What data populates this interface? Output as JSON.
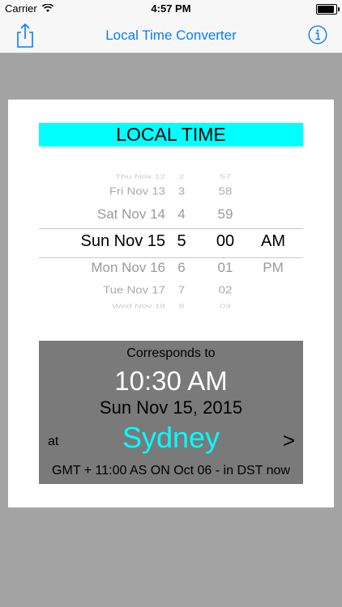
{
  "status": {
    "carrier": "Carrier",
    "time": "4:57 PM",
    "battery_level": 1.0
  },
  "nav": {
    "title": "Local Time Converter",
    "left_icon": "share-icon",
    "right_icon": "info-icon"
  },
  "colors": {
    "accent": "#0a7aff",
    "cyan": "#00ffff",
    "panel": "#7a7a7a",
    "background": "#a3a3a3"
  },
  "header": {
    "label": "LOCAL TIME"
  },
  "picker": {
    "dates": [
      "Thu Nov 12",
      "Fri Nov 13",
      "Sat Nov 14",
      "Sun Nov 15",
      "Mon Nov 16",
      "Tue Nov 17",
      "Wed Nov 18"
    ],
    "hours": [
      "2",
      "3",
      "4",
      "5",
      "6",
      "7",
      "8"
    ],
    "minutes": [
      "57",
      "58",
      "59",
      "00",
      "01",
      "02",
      "03"
    ],
    "ampm": [
      "AM",
      "PM"
    ],
    "selected": {
      "date": "Sun Nov 15",
      "hour": "5",
      "minute": "00",
      "ampm": "AM"
    }
  },
  "result": {
    "label": "Corresponds to",
    "time": "10:30 AM",
    "date": "Sun Nov 15, 2015",
    "at_label": "at",
    "city": "Sydney",
    "arrow": ">",
    "gmt_info": "GMT + 11:00 AS ON Oct 06 - in DST now"
  }
}
